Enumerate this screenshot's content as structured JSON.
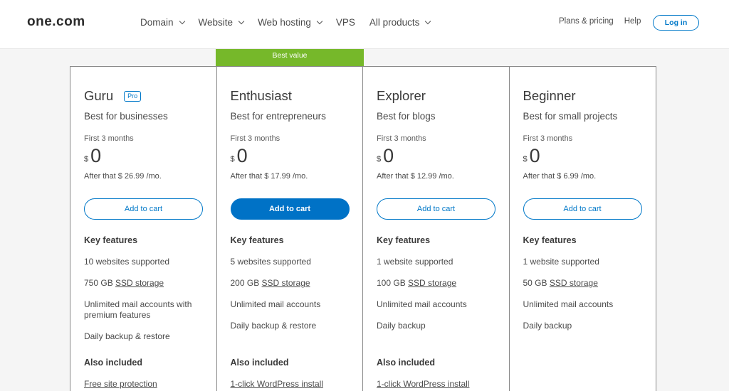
{
  "header": {
    "logo": "one.com",
    "nav": [
      {
        "label": "Domain",
        "dropdown": true
      },
      {
        "label": "Website",
        "dropdown": true
      },
      {
        "label": "Web hosting",
        "dropdown": true
      },
      {
        "label": "VPS",
        "dropdown": false
      },
      {
        "label": "All products",
        "dropdown": true
      }
    ],
    "plans_pricing": "Plans & pricing",
    "help": "Help",
    "login": "Log in"
  },
  "best_value": "Best value",
  "plans": [
    {
      "name": "Guru",
      "badge": "Pro",
      "tagline": "Best for businesses",
      "first": "First 3 months",
      "currency": "$",
      "price": "0",
      "after": "After that $ 26.99 /mo.",
      "cart": "Add to cart",
      "key_features": "Key features",
      "features": [
        {
          "text": "10 websites supported"
        },
        {
          "pre": "750 GB ",
          "link": "SSD storage"
        },
        {
          "text": "Unlimited mail accounts with premium features"
        },
        {
          "text": "Daily backup & restore"
        }
      ],
      "also_included": "Also included",
      "also_item": "Free site protection"
    },
    {
      "name": "Enthusiast",
      "badge": "",
      "tagline": "Best for entrepreneurs",
      "first": "First 3 months",
      "currency": "$",
      "price": "0",
      "after": "After that $ 17.99 /mo.",
      "cart": "Add to cart",
      "key_features": "Key features",
      "features": [
        {
          "text": "5 websites supported"
        },
        {
          "pre": "200 GB ",
          "link": "SSD storage"
        },
        {
          "text": "Unlimited mail accounts"
        },
        {
          "text": "Daily backup & restore"
        }
      ],
      "also_included": "Also included",
      "also_item": "1-click WordPress install"
    },
    {
      "name": "Explorer",
      "badge": "",
      "tagline": "Best for blogs",
      "first": "First 3 months",
      "currency": "$",
      "price": "0",
      "after": "After that $ 12.99 /mo.",
      "cart": "Add to cart",
      "key_features": "Key features",
      "features": [
        {
          "text": "1 website supported"
        },
        {
          "pre": "100 GB ",
          "link": "SSD storage"
        },
        {
          "text": "Unlimited mail accounts"
        },
        {
          "text": "Daily backup"
        }
      ],
      "also_included": "Also included",
      "also_item": "1-click WordPress install"
    },
    {
      "name": "Beginner",
      "badge": "",
      "tagline": "Best for small projects",
      "first": "First 3 months",
      "currency": "$",
      "price": "0",
      "after": "After that $ 6.99 /mo.",
      "cart": "Add to cart",
      "key_features": "Key features",
      "features": [
        {
          "text": "1 website supported"
        },
        {
          "pre": "50 GB ",
          "link": "SSD storage"
        },
        {
          "text": "Unlimited mail accounts"
        },
        {
          "text": "Daily backup"
        }
      ],
      "also_included": "",
      "also_item": ""
    }
  ],
  "colors": {
    "accent": "#0072c6",
    "best_value": "#76b82a"
  }
}
